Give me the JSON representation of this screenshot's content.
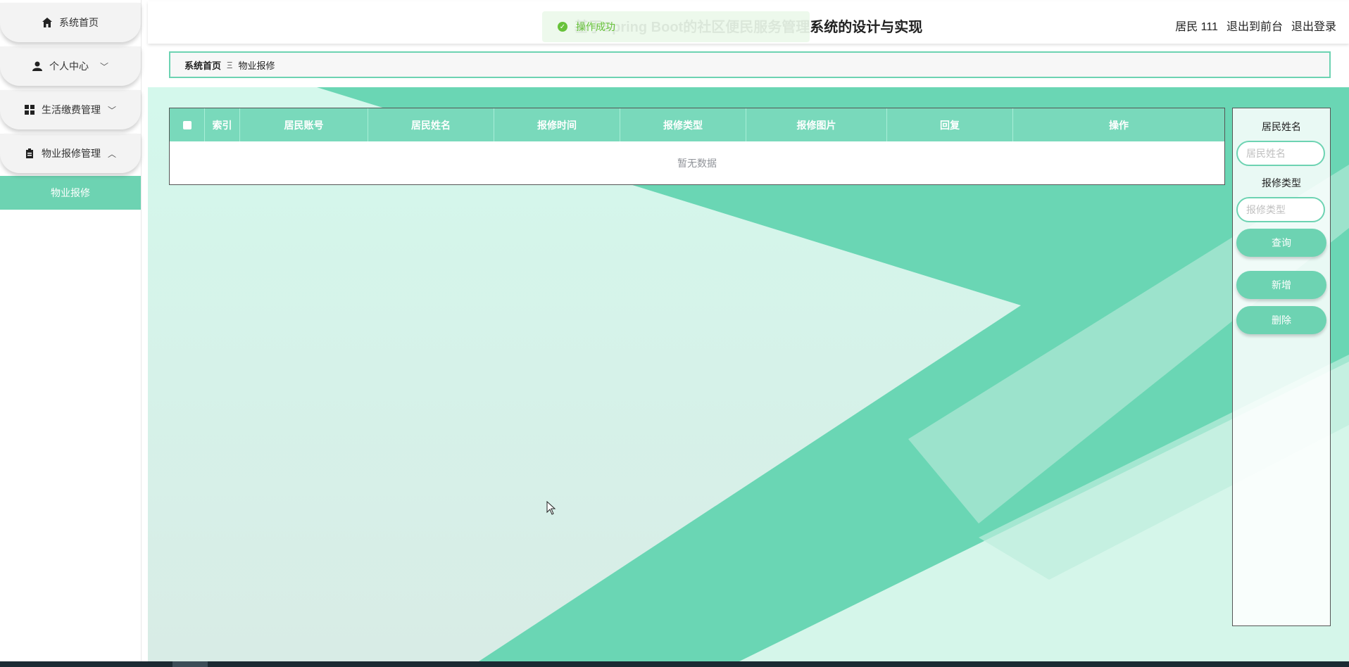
{
  "header": {
    "title": "基于Spring Boot的社区便民服务管理系统的设计与实现",
    "user": "居民 111",
    "to_front": "退出到前台",
    "logout": "退出登录"
  },
  "toast": {
    "message": "操作成功"
  },
  "sidebar": {
    "items": [
      {
        "label": "系统首页",
        "icon": "home-icon"
      },
      {
        "label": "个人中心",
        "icon": "user-icon"
      },
      {
        "label": "生活缴费管理",
        "icon": "grid-icon"
      },
      {
        "label": "物业报修管理",
        "icon": "clipboard-icon"
      }
    ],
    "submenu": {
      "label": "物业报修"
    }
  },
  "breadcrumb": {
    "home": "系统首页",
    "separator": "Ξ",
    "current": "物业报修"
  },
  "table": {
    "columns": [
      "",
      "索引",
      "居民账号",
      "居民姓名",
      "报修时间",
      "报修类型",
      "报修图片",
      "回复",
      "操作"
    ],
    "empty_text": "暂无数据"
  },
  "search": {
    "name_label": "居民姓名",
    "name_placeholder": "居民姓名",
    "type_label": "报修类型",
    "type_placeholder": "报修类型",
    "query_button": "查询",
    "add_button": "新增",
    "delete_button": "删除"
  },
  "colors": {
    "accent": "#6dd3b2",
    "header_cell": "#79d9bb"
  }
}
